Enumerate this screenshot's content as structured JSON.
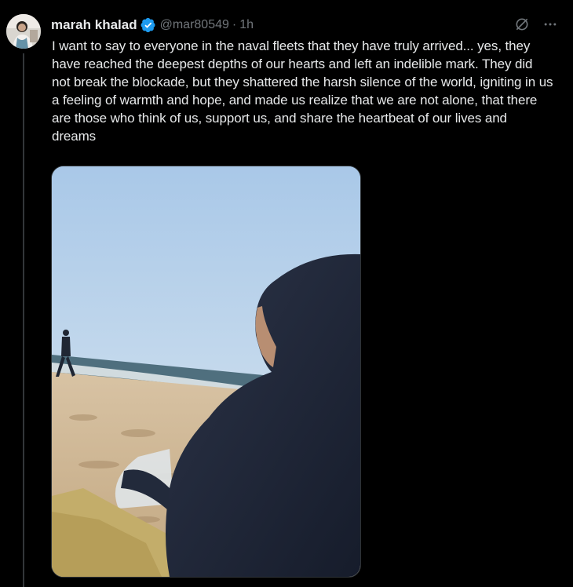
{
  "tweet": {
    "display_name": "marah khalad",
    "handle": "@mar80549",
    "separator": "·",
    "time": "1h",
    "text": "I want to say to everyone in the naval fleets that they have truly arrived... yes, they have reached the deepest depths of our hearts and left an indelible mark. They did not break the blockade, but they shattered the harsh silence of the world, igniting in us a feeling of warmth and hope, and made us realize that we are not alone, that there are those who think of us, support us, and share the heartbeat of our lives and dreams",
    "verified_icon": "verified-badge-icon",
    "media_description_icon": "beach-photo"
  },
  "actions": {
    "grok_icon": "grok-icon",
    "more_icon": "more-icon"
  },
  "colors": {
    "background": "#000000",
    "text": "#e7e9ea",
    "muted": "#71767b",
    "verified": "#1d9bf0",
    "thread_line": "#333639"
  }
}
